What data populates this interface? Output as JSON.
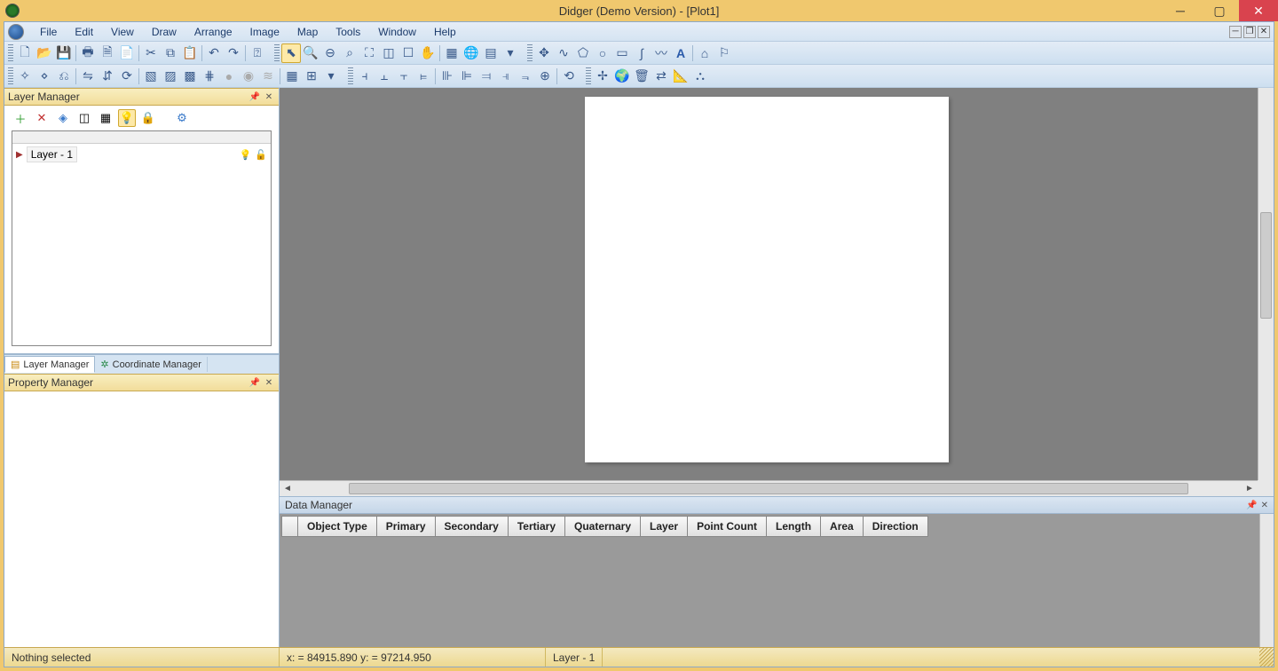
{
  "window": {
    "title": "Didger (Demo Version) - [Plot1]"
  },
  "menu": {
    "items": [
      "File",
      "Edit",
      "View",
      "Draw",
      "Arrange",
      "Image",
      "Map",
      "Tools",
      "Window",
      "Help"
    ]
  },
  "panels": {
    "layer_manager": {
      "title": "Layer Manager",
      "layer1_name": "Layer - 1"
    },
    "property_manager": {
      "title": "Property Manager"
    },
    "data_manager": {
      "title": "Data Manager",
      "columns": [
        "Object Type",
        "Primary",
        "Secondary",
        "Tertiary",
        "Quaternary",
        "Layer",
        "Point Count",
        "Length",
        "Area",
        "Direction"
      ]
    },
    "tabs": {
      "layer": "Layer Manager",
      "coord": "Coordinate Manager"
    }
  },
  "status": {
    "selection": "Nothing selected",
    "coords": "x: = 84915.890 y: = 97214.950",
    "layer": "Layer - 1"
  }
}
